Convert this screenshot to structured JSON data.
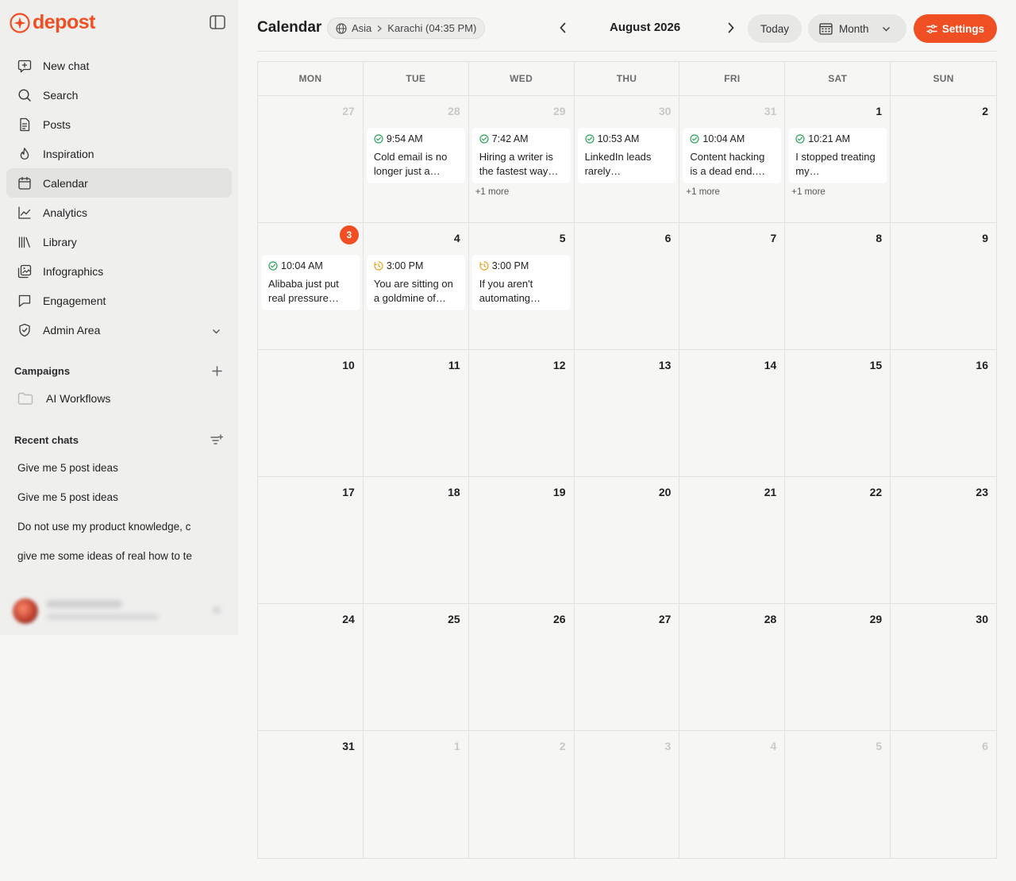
{
  "app": {
    "logo_text": "depost"
  },
  "sidebar": {
    "nav": [
      {
        "label": "New chat",
        "icon": "new-chat-icon"
      },
      {
        "label": "Search",
        "icon": "search-icon"
      },
      {
        "label": "Posts",
        "icon": "document-icon"
      },
      {
        "label": "Inspiration",
        "icon": "flame-icon"
      },
      {
        "label": "Calendar",
        "icon": "calendar-icon",
        "active": true
      },
      {
        "label": "Analytics",
        "icon": "line-chart-icon"
      },
      {
        "label": "Library",
        "icon": "library-icon"
      },
      {
        "label": "Infographics",
        "icon": "image-gallery-icon"
      },
      {
        "label": "Engagement",
        "icon": "chat-bubble-icon"
      },
      {
        "label": "Admin Area",
        "icon": "shield-icon",
        "expandable": true
      }
    ],
    "campaigns": {
      "title": "Campaigns",
      "items": [
        {
          "label": "AI Workflows"
        }
      ]
    },
    "recent": {
      "title": "Recent chats",
      "items": [
        "Give me 5 post ideas",
        "Give me 5 post ideas",
        "Do not use my product knowledge, c",
        "give me some ideas of real how to te"
      ]
    }
  },
  "header": {
    "title": "Calendar",
    "tz_region": "Asia",
    "tz_city": "Karachi (04:35 PM)",
    "month_label": "August 2026",
    "today_label": "Today",
    "view_label": "Month",
    "settings_label": "Settings"
  },
  "calendar": {
    "weekdays": [
      "MON",
      "TUE",
      "WED",
      "THU",
      "FRI",
      "SAT",
      "SUN"
    ],
    "today_day": "3",
    "days": [
      {
        "d": "27",
        "muted": true
      },
      {
        "d": "28",
        "muted": true,
        "event": {
          "time": "9:54 AM",
          "status": "published",
          "text": "Cold email is no longer just a…"
        }
      },
      {
        "d": "29",
        "muted": true,
        "event": {
          "time": "7:42 AM",
          "status": "published",
          "text": "Hiring a writer is the fastest way…"
        },
        "more": "+1 more"
      },
      {
        "d": "30",
        "muted": true,
        "event": {
          "time": "10:53 AM",
          "status": "published",
          "text": "LinkedIn leads rarely announce…"
        }
      },
      {
        "d": "31",
        "muted": true,
        "event": {
          "time": "10:04 AM",
          "status": "published",
          "text": "Content hacking is a dead end.…"
        },
        "more": "+1 more"
      },
      {
        "d": "1",
        "event": {
          "time": "10:21 AM",
          "status": "published",
          "text": "I stopped treating my…"
        },
        "more": "+1 more"
      },
      {
        "d": "2"
      },
      {
        "d": "3",
        "today": true,
        "event": {
          "time": "10:04 AM",
          "status": "published",
          "text": "Alibaba just put real pressure on…"
        }
      },
      {
        "d": "4",
        "event": {
          "time": "3:00 PM",
          "status": "scheduled",
          "text": "You are sitting on a goldmine of…"
        }
      },
      {
        "d": "5",
        "event": {
          "time": "3:00 PM",
          "status": "scheduled",
          "text": "If you aren't automating your…"
        }
      },
      {
        "d": "6"
      },
      {
        "d": "7"
      },
      {
        "d": "8"
      },
      {
        "d": "9"
      },
      {
        "d": "10"
      },
      {
        "d": "11"
      },
      {
        "d": "12"
      },
      {
        "d": "13"
      },
      {
        "d": "14"
      },
      {
        "d": "15"
      },
      {
        "d": "16"
      },
      {
        "d": "17"
      },
      {
        "d": "18"
      },
      {
        "d": "19"
      },
      {
        "d": "20"
      },
      {
        "d": "21"
      },
      {
        "d": "22"
      },
      {
        "d": "23"
      },
      {
        "d": "24"
      },
      {
        "d": "25"
      },
      {
        "d": "26"
      },
      {
        "d": "27"
      },
      {
        "d": "28"
      },
      {
        "d": "29"
      },
      {
        "d": "30"
      },
      {
        "d": "31"
      },
      {
        "d": "1",
        "muted": true
      },
      {
        "d": "2",
        "muted": true
      },
      {
        "d": "3",
        "muted": true
      },
      {
        "d": "4",
        "muted": true
      },
      {
        "d": "5",
        "muted": true
      },
      {
        "d": "6",
        "muted": true
      }
    ]
  },
  "colors": {
    "brand": "#f04e23",
    "published": "#2aa55a",
    "scheduled": "#e8a21b"
  }
}
